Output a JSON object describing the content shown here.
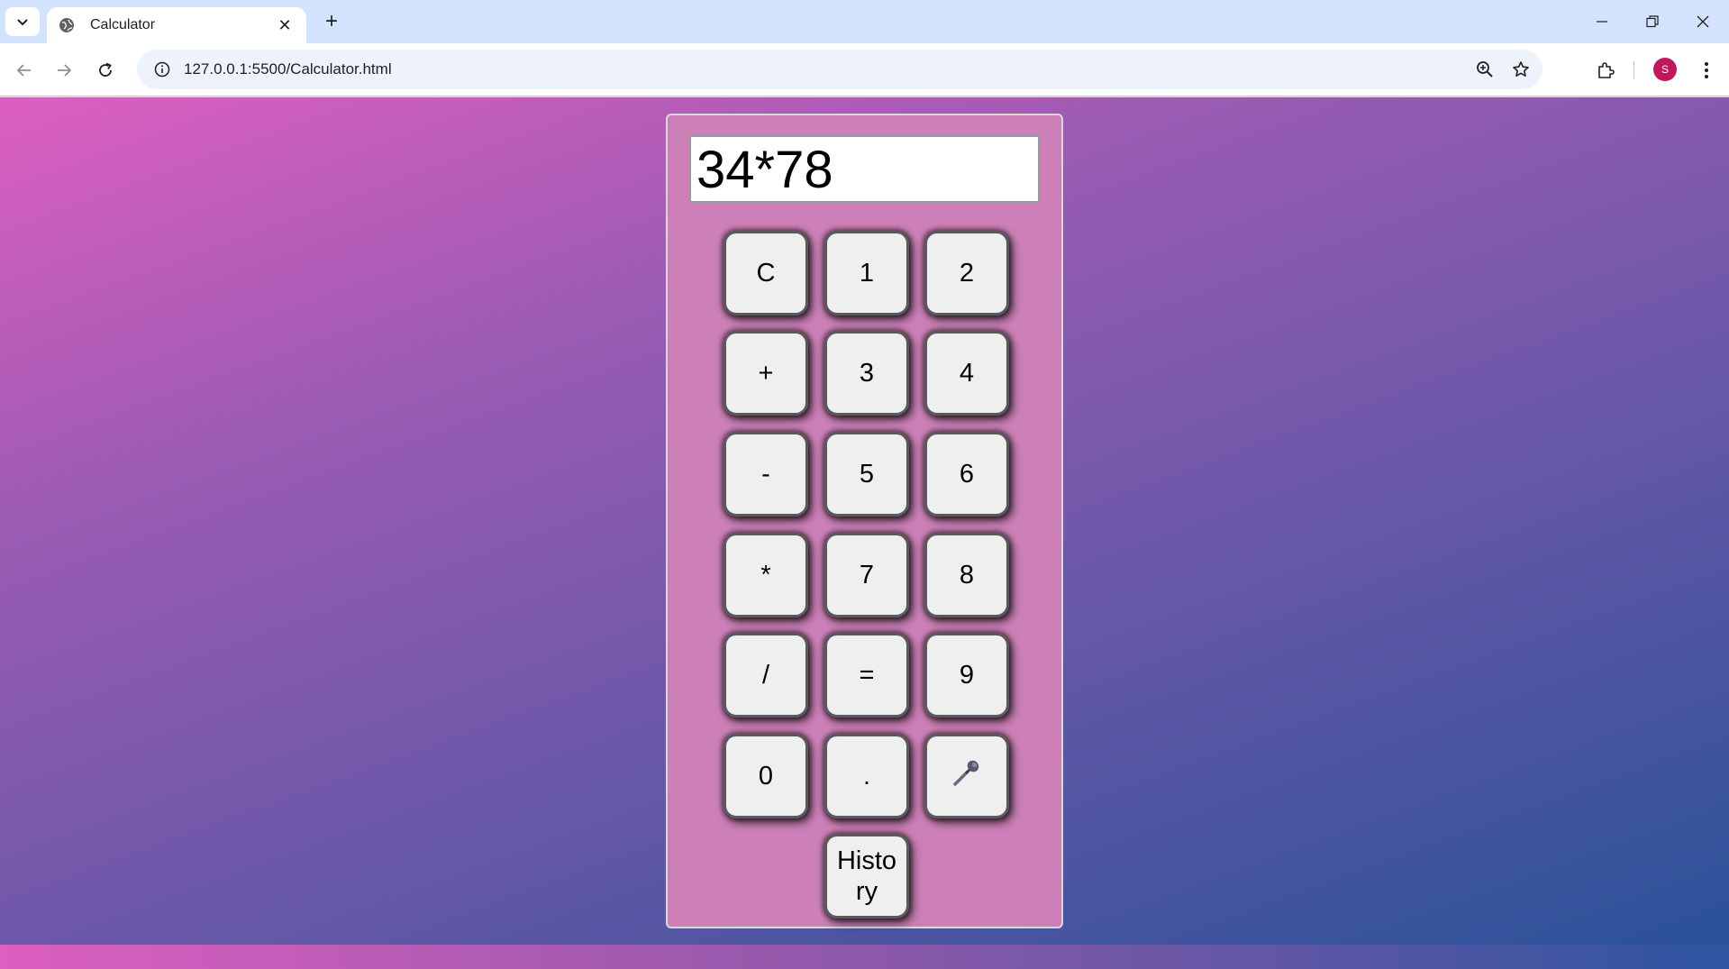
{
  "browser": {
    "tab_title": "Calculator",
    "url": "127.0.0.1:5500/Calculator.html",
    "profile_initial": "S",
    "icons": [
      "tab-search-icon",
      "globe-icon",
      "close-icon",
      "plus-icon",
      "minimize-icon",
      "restore-icon",
      "window-close-icon",
      "back-arrow-icon",
      "forward-arrow-icon",
      "reload-icon",
      "info-icon",
      "zoom-icon",
      "star-icon",
      "extensions-icon",
      "kebab-menu-icon"
    ]
  },
  "calculator": {
    "display_value": "34*78",
    "keys": {
      "clear": "C",
      "one": "1",
      "two": "2",
      "plus": "+",
      "three": "3",
      "four": "4",
      "minus": "-",
      "five": "5",
      "six": "6",
      "multiply": "*",
      "seven": "7",
      "eight": "8",
      "divide": "/",
      "equals": "=",
      "nine": "9",
      "zero": "0",
      "decimal": ".",
      "history": "History"
    },
    "mic_icon": "microphone-icon"
  },
  "colors": {
    "panel": "#cd80b8",
    "key_face": "#efefef",
    "gradient_start": "#dd5fc0",
    "gradient_end": "#2a5299",
    "avatar": "#c2185b"
  }
}
